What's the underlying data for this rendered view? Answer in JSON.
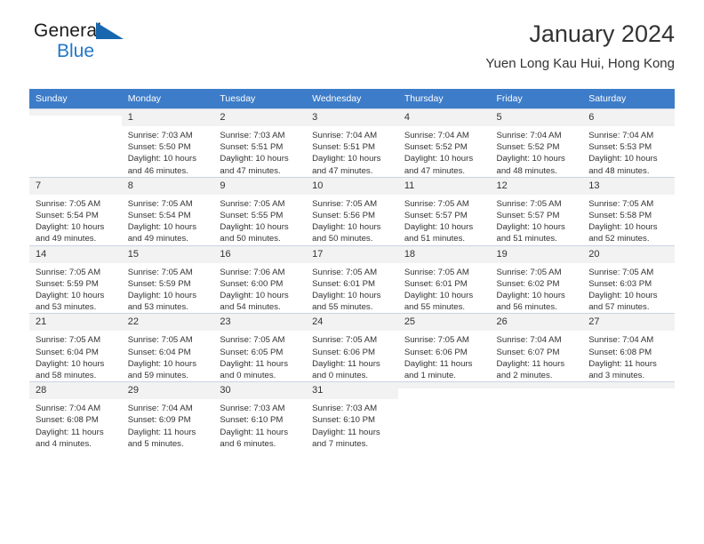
{
  "logo": {
    "word_top": "General",
    "word_bottom": "Blue",
    "triangle_color": "#1667ae",
    "blue_color": "#2277c8"
  },
  "header": {
    "title": "January 2024",
    "subtitle": "Yuen Long Kau Hui, Hong Kong"
  },
  "theme": {
    "header_row_bg": "#3d7cc9",
    "header_row_text": "#ffffff",
    "daynum_bg": "#f2f2f2",
    "grid_line": "#c8d4e4",
    "body_text": "#333333"
  },
  "weekdays": [
    "Sunday",
    "Monday",
    "Tuesday",
    "Wednesday",
    "Thursday",
    "Friday",
    "Saturday"
  ],
  "calendar": {
    "month": "January",
    "year": "2024",
    "weeks": [
      [
        {
          "day": "",
          "sunrise": "",
          "sunset": "",
          "daylight_1": "",
          "daylight_2": "",
          "empty": true
        },
        {
          "day": "1",
          "sunrise": "Sunrise: 7:03 AM",
          "sunset": "Sunset: 5:50 PM",
          "daylight_1": "Daylight: 10 hours",
          "daylight_2": "and 46 minutes."
        },
        {
          "day": "2",
          "sunrise": "Sunrise: 7:03 AM",
          "sunset": "Sunset: 5:51 PM",
          "daylight_1": "Daylight: 10 hours",
          "daylight_2": "and 47 minutes."
        },
        {
          "day": "3",
          "sunrise": "Sunrise: 7:04 AM",
          "sunset": "Sunset: 5:51 PM",
          "daylight_1": "Daylight: 10 hours",
          "daylight_2": "and 47 minutes."
        },
        {
          "day": "4",
          "sunrise": "Sunrise: 7:04 AM",
          "sunset": "Sunset: 5:52 PM",
          "daylight_1": "Daylight: 10 hours",
          "daylight_2": "and 47 minutes."
        },
        {
          "day": "5",
          "sunrise": "Sunrise: 7:04 AM",
          "sunset": "Sunset: 5:52 PM",
          "daylight_1": "Daylight: 10 hours",
          "daylight_2": "and 48 minutes."
        },
        {
          "day": "6",
          "sunrise": "Sunrise: 7:04 AM",
          "sunset": "Sunset: 5:53 PM",
          "daylight_1": "Daylight: 10 hours",
          "daylight_2": "and 48 minutes."
        }
      ],
      [
        {
          "day": "7",
          "sunrise": "Sunrise: 7:05 AM",
          "sunset": "Sunset: 5:54 PM",
          "daylight_1": "Daylight: 10 hours",
          "daylight_2": "and 49 minutes."
        },
        {
          "day": "8",
          "sunrise": "Sunrise: 7:05 AM",
          "sunset": "Sunset: 5:54 PM",
          "daylight_1": "Daylight: 10 hours",
          "daylight_2": "and 49 minutes."
        },
        {
          "day": "9",
          "sunrise": "Sunrise: 7:05 AM",
          "sunset": "Sunset: 5:55 PM",
          "daylight_1": "Daylight: 10 hours",
          "daylight_2": "and 50 minutes."
        },
        {
          "day": "10",
          "sunrise": "Sunrise: 7:05 AM",
          "sunset": "Sunset: 5:56 PM",
          "daylight_1": "Daylight: 10 hours",
          "daylight_2": "and 50 minutes."
        },
        {
          "day": "11",
          "sunrise": "Sunrise: 7:05 AM",
          "sunset": "Sunset: 5:57 PM",
          "daylight_1": "Daylight: 10 hours",
          "daylight_2": "and 51 minutes."
        },
        {
          "day": "12",
          "sunrise": "Sunrise: 7:05 AM",
          "sunset": "Sunset: 5:57 PM",
          "daylight_1": "Daylight: 10 hours",
          "daylight_2": "and 51 minutes."
        },
        {
          "day": "13",
          "sunrise": "Sunrise: 7:05 AM",
          "sunset": "Sunset: 5:58 PM",
          "daylight_1": "Daylight: 10 hours",
          "daylight_2": "and 52 minutes."
        }
      ],
      [
        {
          "day": "14",
          "sunrise": "Sunrise: 7:05 AM",
          "sunset": "Sunset: 5:59 PM",
          "daylight_1": "Daylight: 10 hours",
          "daylight_2": "and 53 minutes."
        },
        {
          "day": "15",
          "sunrise": "Sunrise: 7:05 AM",
          "sunset": "Sunset: 5:59 PM",
          "daylight_1": "Daylight: 10 hours",
          "daylight_2": "and 53 minutes."
        },
        {
          "day": "16",
          "sunrise": "Sunrise: 7:06 AM",
          "sunset": "Sunset: 6:00 PM",
          "daylight_1": "Daylight: 10 hours",
          "daylight_2": "and 54 minutes."
        },
        {
          "day": "17",
          "sunrise": "Sunrise: 7:05 AM",
          "sunset": "Sunset: 6:01 PM",
          "daylight_1": "Daylight: 10 hours",
          "daylight_2": "and 55 minutes."
        },
        {
          "day": "18",
          "sunrise": "Sunrise: 7:05 AM",
          "sunset": "Sunset: 6:01 PM",
          "daylight_1": "Daylight: 10 hours",
          "daylight_2": "and 55 minutes."
        },
        {
          "day": "19",
          "sunrise": "Sunrise: 7:05 AM",
          "sunset": "Sunset: 6:02 PM",
          "daylight_1": "Daylight: 10 hours",
          "daylight_2": "and 56 minutes."
        },
        {
          "day": "20",
          "sunrise": "Sunrise: 7:05 AM",
          "sunset": "Sunset: 6:03 PM",
          "daylight_1": "Daylight: 10 hours",
          "daylight_2": "and 57 minutes."
        }
      ],
      [
        {
          "day": "21",
          "sunrise": "Sunrise: 7:05 AM",
          "sunset": "Sunset: 6:04 PM",
          "daylight_1": "Daylight: 10 hours",
          "daylight_2": "and 58 minutes."
        },
        {
          "day": "22",
          "sunrise": "Sunrise: 7:05 AM",
          "sunset": "Sunset: 6:04 PM",
          "daylight_1": "Daylight: 10 hours",
          "daylight_2": "and 59 minutes."
        },
        {
          "day": "23",
          "sunrise": "Sunrise: 7:05 AM",
          "sunset": "Sunset: 6:05 PM",
          "daylight_1": "Daylight: 11 hours",
          "daylight_2": "and 0 minutes."
        },
        {
          "day": "24",
          "sunrise": "Sunrise: 7:05 AM",
          "sunset": "Sunset: 6:06 PM",
          "daylight_1": "Daylight: 11 hours",
          "daylight_2": "and 0 minutes."
        },
        {
          "day": "25",
          "sunrise": "Sunrise: 7:05 AM",
          "sunset": "Sunset: 6:06 PM",
          "daylight_1": "Daylight: 11 hours",
          "daylight_2": "and 1 minute."
        },
        {
          "day": "26",
          "sunrise": "Sunrise: 7:04 AM",
          "sunset": "Sunset: 6:07 PM",
          "daylight_1": "Daylight: 11 hours",
          "daylight_2": "and 2 minutes."
        },
        {
          "day": "27",
          "sunrise": "Sunrise: 7:04 AM",
          "sunset": "Sunset: 6:08 PM",
          "daylight_1": "Daylight: 11 hours",
          "daylight_2": "and 3 minutes."
        }
      ],
      [
        {
          "day": "28",
          "sunrise": "Sunrise: 7:04 AM",
          "sunset": "Sunset: 6:08 PM",
          "daylight_1": "Daylight: 11 hours",
          "daylight_2": "and 4 minutes."
        },
        {
          "day": "29",
          "sunrise": "Sunrise: 7:04 AM",
          "sunset": "Sunset: 6:09 PM",
          "daylight_1": "Daylight: 11 hours",
          "daylight_2": "and 5 minutes."
        },
        {
          "day": "30",
          "sunrise": "Sunrise: 7:03 AM",
          "sunset": "Sunset: 6:10 PM",
          "daylight_1": "Daylight: 11 hours",
          "daylight_2": "and 6 minutes."
        },
        {
          "day": "31",
          "sunrise": "Sunrise: 7:03 AM",
          "sunset": "Sunset: 6:10 PM",
          "daylight_1": "Daylight: 11 hours",
          "daylight_2": "and 7 minutes."
        },
        {
          "day": "",
          "sunrise": "",
          "sunset": "",
          "daylight_1": "",
          "daylight_2": "",
          "empty": true
        },
        {
          "day": "",
          "sunrise": "",
          "sunset": "",
          "daylight_1": "",
          "daylight_2": "",
          "empty": true
        },
        {
          "day": "",
          "sunrise": "",
          "sunset": "",
          "daylight_1": "",
          "daylight_2": "",
          "empty": true
        }
      ]
    ]
  }
}
